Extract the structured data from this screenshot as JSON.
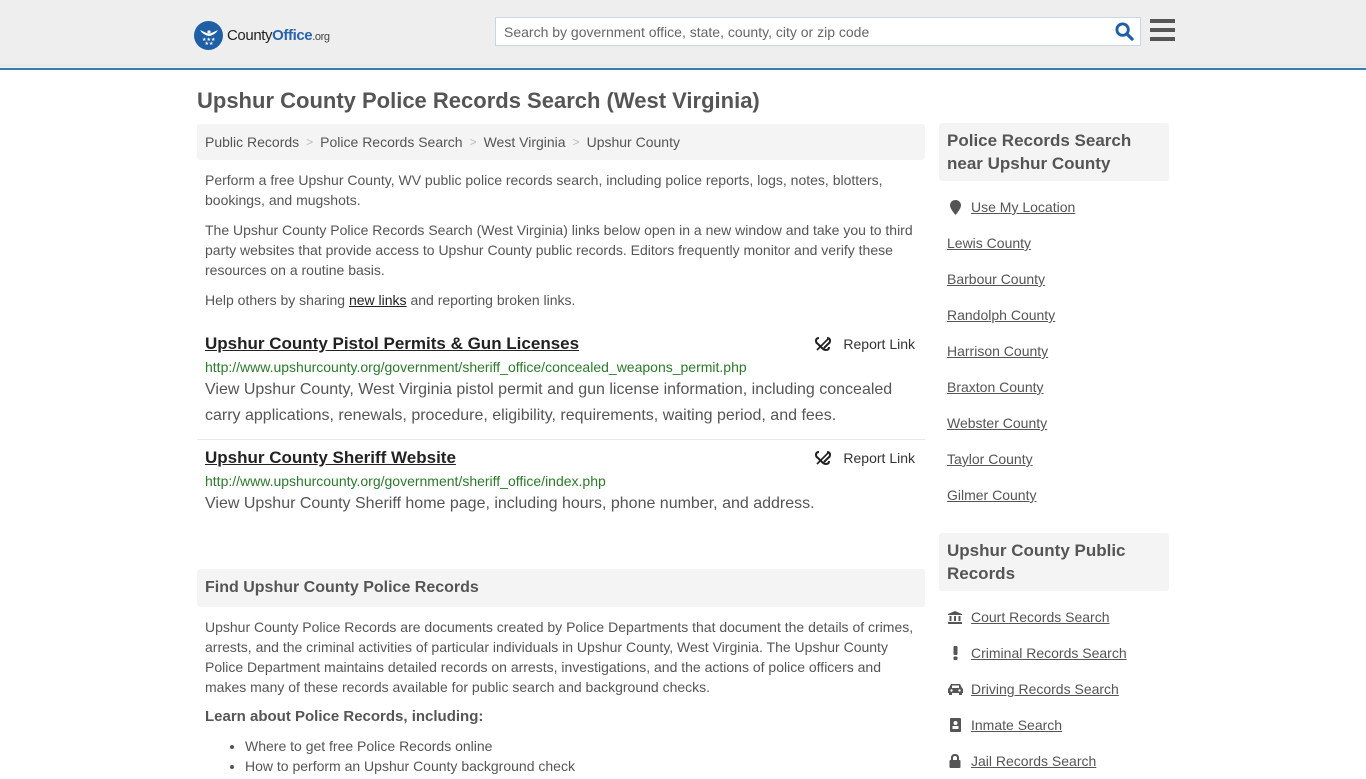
{
  "header": {
    "logo": {
      "county": "County",
      "office": "Office",
      "org": ".org"
    },
    "search": {
      "placeholder": "Search by government office, state, county, city or zip code",
      "value": ""
    },
    "icons": {
      "search": "search-icon",
      "menu": "hamburger-menu-icon"
    }
  },
  "page": {
    "title": "Upshur County Police Records Search (West Virginia)"
  },
  "breadcrumb": [
    {
      "label": "Public Records"
    },
    {
      "label": "Police Records Search"
    },
    {
      "label": "West Virginia"
    },
    {
      "label": "Upshur County"
    }
  ],
  "intro": {
    "p1": "Perform a free Upshur County, WV public police records search, including police reports, logs, notes, blotters, bookings, and mugshots.",
    "p2": "The Upshur County Police Records Search (West Virginia) links below open in a new window and take you to third party websites that provide access to Upshur County public records. Editors frequently monitor and verify these resources on a routine basis.",
    "p3_before": "Help others by sharing ",
    "p3_link": "new links",
    "p3_after": " and reporting broken links."
  },
  "results": [
    {
      "title": "Upshur County Pistol Permits & Gun Licenses",
      "url": "http://www.upshurcounty.org/government/sheriff_office/concealed_weapons_permit.php",
      "description": "View Upshur County, West Virginia pistol permit and gun license information, including concealed carry applications, renewals, procedure, eligibility, requirements, waiting period, and fees.",
      "report_label": "Report Link"
    },
    {
      "title": "Upshur County Sheriff Website",
      "url": "http://www.upshurcounty.org/government/sheriff_office/index.php",
      "description": "View Upshur County Sheriff home page, including hours, phone number, and address.",
      "report_label": "Report Link"
    }
  ],
  "find_section": {
    "heading": "Find Upshur County Police Records",
    "paragraph": "Upshur County Police Records are documents created by Police Departments that document the details of crimes, arrests, and the criminal activities of particular individuals in Upshur County, West Virginia. The Upshur County Police Department maintains detailed records on arrests, investigations, and the actions of police officers and makes many of these records available for public search and background checks.",
    "subheading": "Learn about Police Records, including:",
    "bullets": [
      "Where to get free Police Records online",
      "How to perform an Upshur County background check"
    ]
  },
  "sidebar": {
    "nearby": {
      "heading": "Police Records Search near Upshur County",
      "use_location": "Use My Location",
      "counties": [
        "Lewis County",
        "Barbour County",
        "Randolph County",
        "Harrison County",
        "Braxton County",
        "Webster County",
        "Taylor County",
        "Gilmer County"
      ]
    },
    "public_records": {
      "heading": "Upshur County Public Records",
      "items": [
        {
          "label": "Court Records Search",
          "icon": "courthouse-icon"
        },
        {
          "label": "Criminal Records Search",
          "icon": "exclamation-icon"
        },
        {
          "label": "Driving Records Search",
          "icon": "car-icon"
        },
        {
          "label": "Inmate Search",
          "icon": "id-badge-icon"
        },
        {
          "label": "Jail Records Search",
          "icon": "lock-icon"
        }
      ]
    }
  }
}
